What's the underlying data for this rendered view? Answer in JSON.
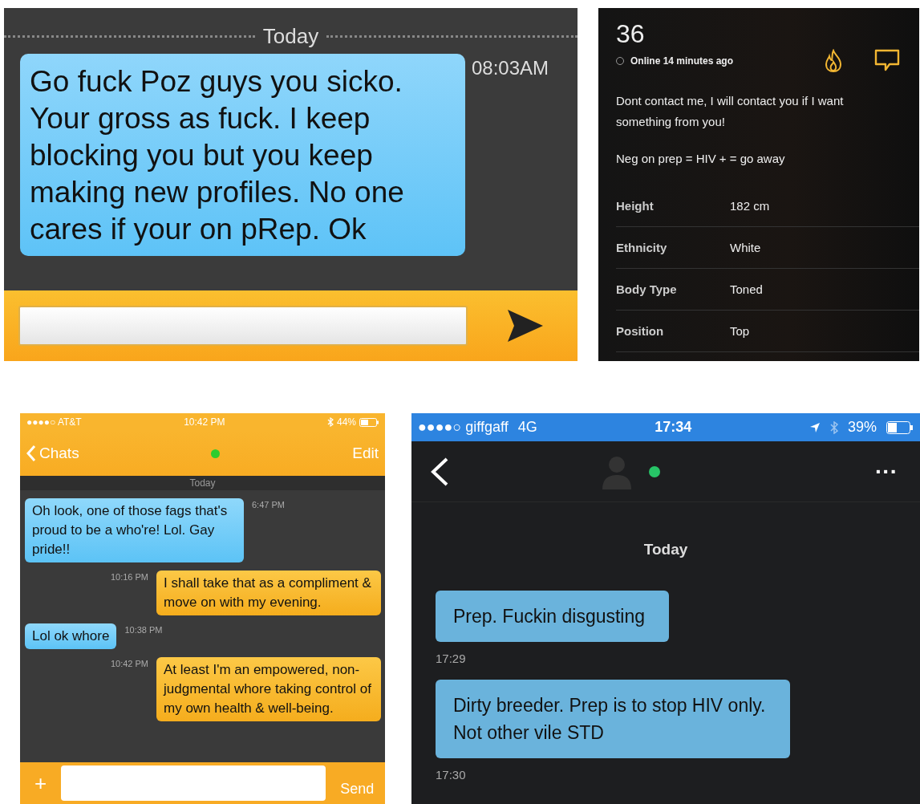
{
  "chat_a": {
    "date_label": "Today",
    "message": {
      "text": "Go fuck Poz guys you sicko. Your gross as fuck. I keep blocking you but you keep making new profiles. No one cares if your on pRep. Ok",
      "time": "08:03AM"
    }
  },
  "profile": {
    "age": "36",
    "status": "Online 14 minutes ago",
    "bio": [
      "Dont contact me, I will contact you if I want something from you!",
      "Neg on prep = HIV + = go away"
    ],
    "details": [
      {
        "label": "Height",
        "value": "182 cm"
      },
      {
        "label": "Ethnicity",
        "value": "White"
      },
      {
        "label": "Body Type",
        "value": "Toned"
      },
      {
        "label": "Position",
        "value": "Top"
      }
    ]
  },
  "chat_b": {
    "status_bar": {
      "carrier": "●●●●○ AT&T",
      "time": "10:42 PM",
      "battery": "44%"
    },
    "back_label": "Chats",
    "edit_label": "Edit",
    "date_label": "Today",
    "messages": [
      {
        "kind": "incoming",
        "text": "Oh look, one of those fags that's proud to be a who're! Lol. Gay pride!!",
        "time": "6:47 PM"
      },
      {
        "kind": "outgoing",
        "text": "I shall take that as a compliment & move on with my evening.",
        "time": "10:16 PM"
      },
      {
        "kind": "incoming",
        "text": "Lol ok whore",
        "time": "10:38 PM"
      },
      {
        "kind": "outgoing",
        "text": "At least I'm an empowered, non-judgmental whore taking control of my own health & well-being.",
        "time": "10:42 PM"
      }
    ],
    "plus_label": "+",
    "send_label": "Send"
  },
  "chat_c": {
    "status_bar": {
      "carrier": "●●●●○ giffgaff",
      "network": "4G",
      "time": "17:34",
      "battery": "39%"
    },
    "menu_label": "···",
    "date_label": "Today",
    "messages": [
      {
        "text": "Prep. Fuckin disgusting",
        "time": "17:29"
      },
      {
        "text": "Dirty breeder. Prep is to stop HIV only. Not other vile STD",
        "time": "17:30"
      }
    ]
  }
}
